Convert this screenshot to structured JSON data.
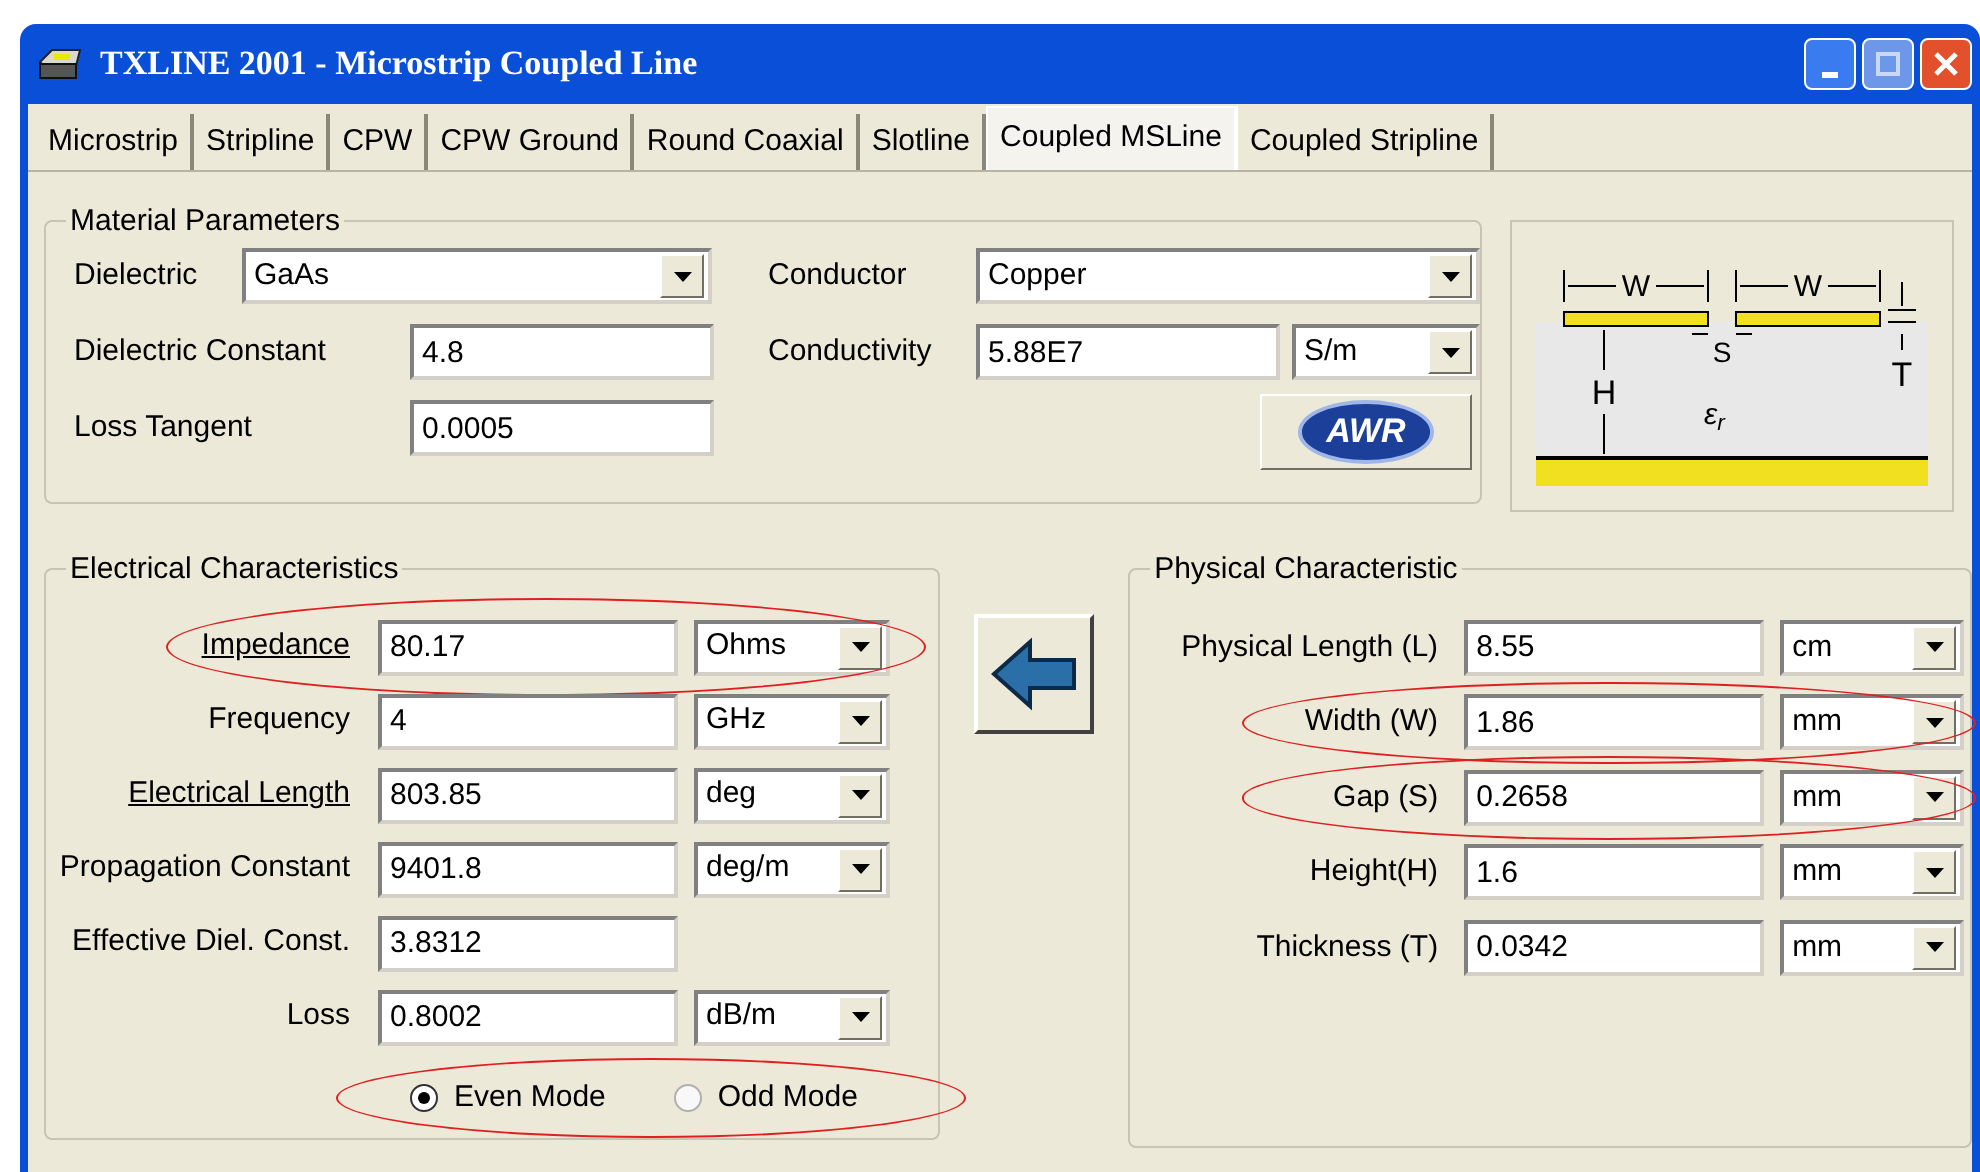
{
  "window": {
    "title": "TXLINE 2001 - Microstrip Coupled Line"
  },
  "tabs": [
    {
      "label": "Microstrip",
      "selected": false
    },
    {
      "label": "Stripline",
      "selected": false
    },
    {
      "label": "CPW",
      "selected": false
    },
    {
      "label": "CPW Ground",
      "selected": false
    },
    {
      "label": "Round Coaxial",
      "selected": false
    },
    {
      "label": "Slotline",
      "selected": false
    },
    {
      "label": "Coupled MSLine",
      "selected": true
    },
    {
      "label": "Coupled Stripline",
      "selected": false
    }
  ],
  "material": {
    "title": "Material Parameters",
    "left": [
      {
        "kind": "select",
        "label": "Dielectric",
        "value": "GaAs"
      },
      {
        "kind": "input",
        "label": "Dielectric Constant",
        "value": "4.8"
      },
      {
        "kind": "input",
        "label": "Loss Tangent",
        "value": "0.0005"
      }
    ],
    "right": [
      {
        "kind": "select",
        "label": "Conductor",
        "value": "Copper"
      },
      {
        "kind": "input_unit",
        "label": "Conductivity",
        "value": "5.88E7",
        "unit": "S/m"
      }
    ],
    "logo": "AWR"
  },
  "diagram": {
    "labels": [
      "W",
      "W",
      "S",
      "H",
      "T",
      "ε$_{r}$"
    ]
  },
  "electrical": {
    "title": "Electrical Characteristics",
    "rows": [
      {
        "label": "Impedance",
        "underlined": true,
        "value": "80.17",
        "unit": "Ohms",
        "highlighted": true
      },
      {
        "label": "Frequency",
        "underlined": false,
        "value": "4",
        "unit": "GHz",
        "highlighted": false
      },
      {
        "label": "Electrical Length",
        "underlined": true,
        "value": "803.85",
        "unit": "deg",
        "highlighted": false
      },
      {
        "label": "Propagation Constant",
        "underlined": false,
        "value": "9401.8",
        "unit": "deg/m",
        "highlighted": false
      },
      {
        "label": "Effective Diel. Const.",
        "underlined": false,
        "value": "3.8312",
        "highlighted": false
      },
      {
        "label": "Loss",
        "underlined": false,
        "value": "0.8002",
        "unit": "dB/m",
        "highlighted": false
      }
    ],
    "modes": [
      {
        "label": "Even Mode",
        "selected": true
      },
      {
        "label": "Odd Mode",
        "selected": false
      }
    ],
    "modes_highlighted": true
  },
  "physical": {
    "title": "Physical Characteristic",
    "rows": [
      {
        "label": "Physical Length (L)",
        "value": "8.55",
        "unit": "cm",
        "highlighted": false
      },
      {
        "label": "Width (W)",
        "value": "1.86",
        "unit": "mm",
        "highlighted": true
      },
      {
        "label": "Gap (S)",
        "value": "0.2658",
        "unit": "mm",
        "highlighted": true
      },
      {
        "label": "Height(H)",
        "value": "1.6",
        "unit": "mm",
        "highlighted": false
      },
      {
        "label": "Thickness (T)",
        "value": "0.0342",
        "unit": "mm",
        "highlighted": false
      }
    ]
  }
}
